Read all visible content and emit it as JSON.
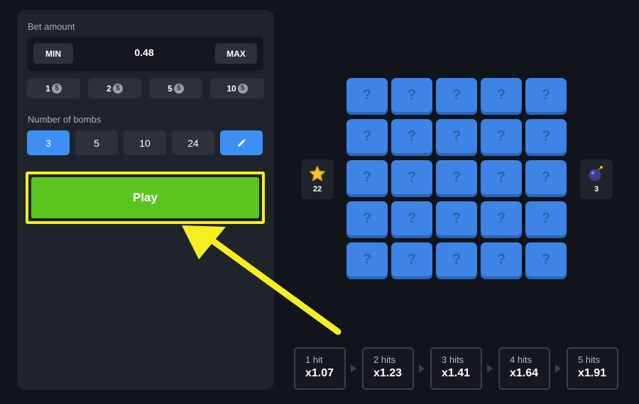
{
  "bet": {
    "label": "Bet amount",
    "min_label": "MIN",
    "max_label": "MAX",
    "value": "0.48",
    "chips": [
      "1",
      "2",
      "5",
      "10"
    ],
    "coin_symbol": "$"
  },
  "bombs": {
    "label": "Number of bombs",
    "options": [
      "3",
      "5",
      "10",
      "24"
    ],
    "selected": "3",
    "edit_icon": "pencil-icon"
  },
  "play": {
    "label": "Play"
  },
  "grid": {
    "rows": 5,
    "cols": 5,
    "tile_symbol": "?"
  },
  "counters": {
    "gems": {
      "icon": "star-icon",
      "value": "22"
    },
    "bombs": {
      "icon": "bomb-icon",
      "value": "3"
    }
  },
  "multipliers": [
    {
      "hits": "1 hit",
      "value": "x1.07"
    },
    {
      "hits": "2 hits",
      "value": "x1.23"
    },
    {
      "hits": "3 hits",
      "value": "x1.41"
    },
    {
      "hits": "4 hits",
      "value": "x1.64"
    },
    {
      "hits": "5 hits",
      "value": "x1.91"
    }
  ],
  "colors": {
    "accent_blue": "#3d8ff5",
    "play_green": "#5bc51f",
    "highlight_yellow": "#f5ef1f",
    "tile_blue": "#3d84e6"
  }
}
